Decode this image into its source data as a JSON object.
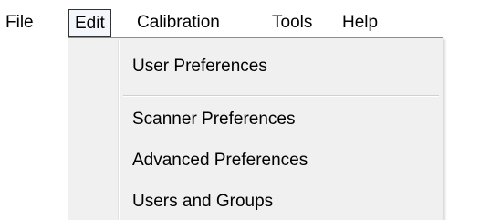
{
  "menubar": {
    "items": [
      {
        "label": "File"
      },
      {
        "label": "Edit"
      },
      {
        "label": "Calibration"
      },
      {
        "label": "Tools"
      },
      {
        "label": "Help"
      }
    ],
    "active": "Edit"
  },
  "dropdown": {
    "items": [
      {
        "label": "User Preferences"
      },
      {
        "label": "Scanner Preferences"
      },
      {
        "label": "Advanced Preferences"
      },
      {
        "label": "Users and Groups"
      }
    ]
  }
}
